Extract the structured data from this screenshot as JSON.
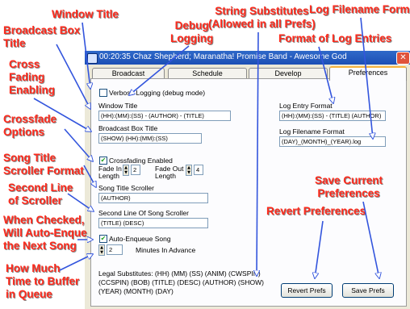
{
  "callouts": {
    "window_title": "Window Title",
    "broadcast_box_title": "Broadcast Box\nTitle",
    "debug_logging": "Debug\nLogging",
    "string_substitutes": "String Substitutes\n(Allowed in all Prefs)",
    "log_filename_format": "Log Filename Format",
    "format_of_log_entries": "Format of Log Entries",
    "cross_fading_enabling": "Cross\nFading\nEnabling",
    "crossfade_options": "Crossfade\nOptions",
    "song_title_scroller_format": "Song Title\nScroller Format",
    "second_line_of_scroller": "Second Line\nof Scroller",
    "when_checked": "When Checked,\nWill Auto-Enque\nthe Next Song",
    "buffer_time": "How Much\nTime to Buffer\nin Queue",
    "revert_preferences": "Revert Preferences",
    "save_current_preferences": "Save Current\nPreferences"
  },
  "window": {
    "title": "00:20:35   Chaz Shepherd; Maranatha! Promise Band - Awesome God",
    "close_glyph": "✕",
    "accent": "#2f69c9"
  },
  "tabs": [
    {
      "label": "Broadcast",
      "active": false
    },
    {
      "label": "Schedule",
      "active": false
    },
    {
      "label": "Develop",
      "active": false
    },
    {
      "label": "Preferences",
      "active": true
    }
  ],
  "prefs": {
    "verbose_logging": {
      "label": "Verbose Logging (debug mode)",
      "checked": false
    },
    "window_title": {
      "label": "Window Title",
      "value": "(HH):(MM):(SS) - (AUTHOR) - (TITLE)"
    },
    "broadcast_box_title": {
      "label": "Broadcast Box Title",
      "value": "(SHOW) (HH):(MM):(SS)"
    },
    "crossfading": {
      "label": "Crossfading Enabled",
      "checked": true
    },
    "fade_in": {
      "label": "Fade In\nLength",
      "value": "2"
    },
    "fade_out": {
      "label": "Fade Out\nLength",
      "value": "4"
    },
    "song_title_scroller": {
      "label": "Song Title Scroller",
      "value": "(AUTHOR)"
    },
    "second_line": {
      "label": "Second Line Of Song Scroller",
      "value": "(TITLE) (DESC)"
    },
    "auto_enqueue": {
      "label": "Auto-Enqueue Song",
      "checked": true
    },
    "minutes_in_advance": {
      "label": "Minutes In Advance",
      "value": "2"
    },
    "log_entry_format": {
      "label": "Log Entry Format",
      "value": "(HH):(MM):(SS) - (TITLE) (AUTHOR)"
    },
    "log_filename_format": {
      "label": "Log Filename Format",
      "value": "(DAY)_(MONTH)_(YEAR).log"
    },
    "legal_substitutes": "Legal Substitutes: (HH) (MM) (SS) (ANIM) (CWSPIN)\n(CCSPIN) (BOB) (TITLE) (DESC) (AUTHOR) (SHOW)\n(YEAR) (MONTH) (DAY)"
  },
  "buttons": {
    "revert": "Revert Prefs",
    "save": "Save Prefs"
  },
  "colors": {
    "callout": "#ff2a1c",
    "arrow": "#3355dd"
  }
}
